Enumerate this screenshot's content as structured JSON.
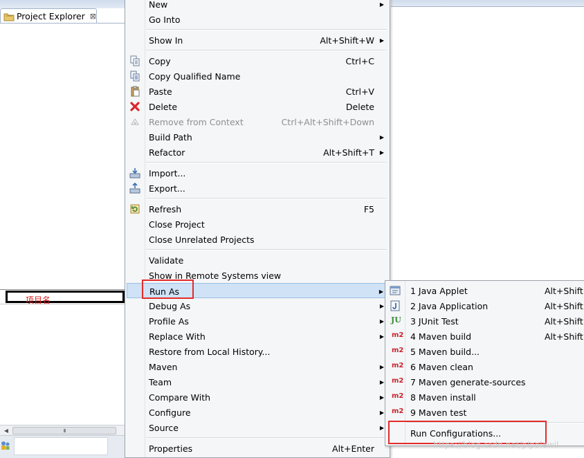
{
  "explorer": {
    "tab_label": "Project Explorer",
    "tab_close": "⊠",
    "project_name": "项目名",
    "scroll_thumb": "III"
  },
  "menu": {
    "items": [
      {
        "label": "New",
        "accel": "",
        "submenu": true,
        "icon": "",
        "disabled": false
      },
      {
        "label": "Go Into",
        "accel": "",
        "submenu": false,
        "icon": "",
        "disabled": false
      },
      {
        "label": "Show In",
        "accel": "Alt+Shift+W",
        "submenu": true,
        "icon": "",
        "disabled": false
      },
      {
        "label": "Copy",
        "accel": "Ctrl+C",
        "submenu": false,
        "icon": "copy-icon",
        "disabled": false
      },
      {
        "label": "Copy Qualified Name",
        "accel": "",
        "submenu": false,
        "icon": "copy-qualified-icon",
        "disabled": false
      },
      {
        "label": "Paste",
        "accel": "Ctrl+V",
        "submenu": false,
        "icon": "paste-icon",
        "disabled": false
      },
      {
        "label": "Delete",
        "accel": "Delete",
        "submenu": false,
        "icon": "delete-icon",
        "disabled": false
      },
      {
        "label": "Remove from Context",
        "accel": "Ctrl+Alt+Shift+Down",
        "submenu": false,
        "icon": "remove-context-icon",
        "disabled": true
      },
      {
        "label": "Build Path",
        "accel": "",
        "submenu": true,
        "icon": "",
        "disabled": false
      },
      {
        "label": "Refactor",
        "accel": "Alt+Shift+T",
        "submenu": true,
        "icon": "",
        "disabled": false
      },
      {
        "label": "Import...",
        "accel": "",
        "submenu": false,
        "icon": "import-icon",
        "disabled": false
      },
      {
        "label": "Export...",
        "accel": "",
        "submenu": false,
        "icon": "export-icon",
        "disabled": false
      },
      {
        "label": "Refresh",
        "accel": "F5",
        "submenu": false,
        "icon": "refresh-icon",
        "disabled": false
      },
      {
        "label": "Close Project",
        "accel": "",
        "submenu": false,
        "icon": "",
        "disabled": false
      },
      {
        "label": "Close Unrelated Projects",
        "accel": "",
        "submenu": false,
        "icon": "",
        "disabled": false
      },
      {
        "label": "Validate",
        "accel": "",
        "submenu": false,
        "icon": "",
        "disabled": false
      },
      {
        "label": "Show in Remote Systems view",
        "accel": "",
        "submenu": false,
        "icon": "",
        "disabled": false
      },
      {
        "label": "Run As",
        "accel": "",
        "submenu": true,
        "icon": "",
        "disabled": false
      },
      {
        "label": "Debug As",
        "accel": "",
        "submenu": true,
        "icon": "",
        "disabled": false
      },
      {
        "label": "Profile As",
        "accel": "",
        "submenu": true,
        "icon": "",
        "disabled": false
      },
      {
        "label": "Replace With",
        "accel": "",
        "submenu": true,
        "icon": "",
        "disabled": false
      },
      {
        "label": "Restore from Local History...",
        "accel": "",
        "submenu": false,
        "icon": "",
        "disabled": false
      },
      {
        "label": "Maven",
        "accel": "",
        "submenu": true,
        "icon": "",
        "disabled": false
      },
      {
        "label": "Team",
        "accel": "",
        "submenu": true,
        "icon": "",
        "disabled": false
      },
      {
        "label": "Compare With",
        "accel": "",
        "submenu": true,
        "icon": "",
        "disabled": false
      },
      {
        "label": "Configure",
        "accel": "",
        "submenu": true,
        "icon": "",
        "disabled": false
      },
      {
        "label": "Source",
        "accel": "",
        "submenu": true,
        "icon": "",
        "disabled": false
      },
      {
        "label": "Properties",
        "accel": "Alt+Enter",
        "submenu": false,
        "icon": "",
        "disabled": false
      }
    ],
    "submenu_arrow": "▶"
  },
  "run_as_submenu": {
    "items": [
      {
        "label": "1 Java Applet",
        "accel": "Alt+Shift+",
        "icon": "java-applet-icon"
      },
      {
        "label": "2 Java Application",
        "accel": "Alt+Shift+",
        "icon": "java-application-icon"
      },
      {
        "label": "3 JUnit Test",
        "accel": "Alt+Shift+",
        "icon": "junit-icon"
      },
      {
        "label": "4 Maven build",
        "accel": "Alt+Shift+X",
        "icon": "maven-m2-icon"
      },
      {
        "label": "5 Maven build...",
        "accel": "",
        "icon": "maven-m2-icon"
      },
      {
        "label": "6 Maven clean",
        "accel": "",
        "icon": "maven-m2-icon"
      },
      {
        "label": "7 Maven generate-sources",
        "accel": "",
        "icon": "maven-m2-icon"
      },
      {
        "label": "8 Maven install",
        "accel": "",
        "icon": "maven-m2-icon"
      },
      {
        "label": "9 Maven test",
        "accel": "",
        "icon": "maven-m2-icon"
      },
      {
        "label": "Run Configurations...",
        "accel": "",
        "icon": ""
      }
    ],
    "m2_text": "m2",
    "ju_text": "JU"
  },
  "watermark": "https://blog.csdn.net/pipolewil",
  "colors": {
    "highlight_red": "#e32b2b",
    "menu_bg": "#f5f6f7",
    "maven_red": "#c8232c"
  }
}
